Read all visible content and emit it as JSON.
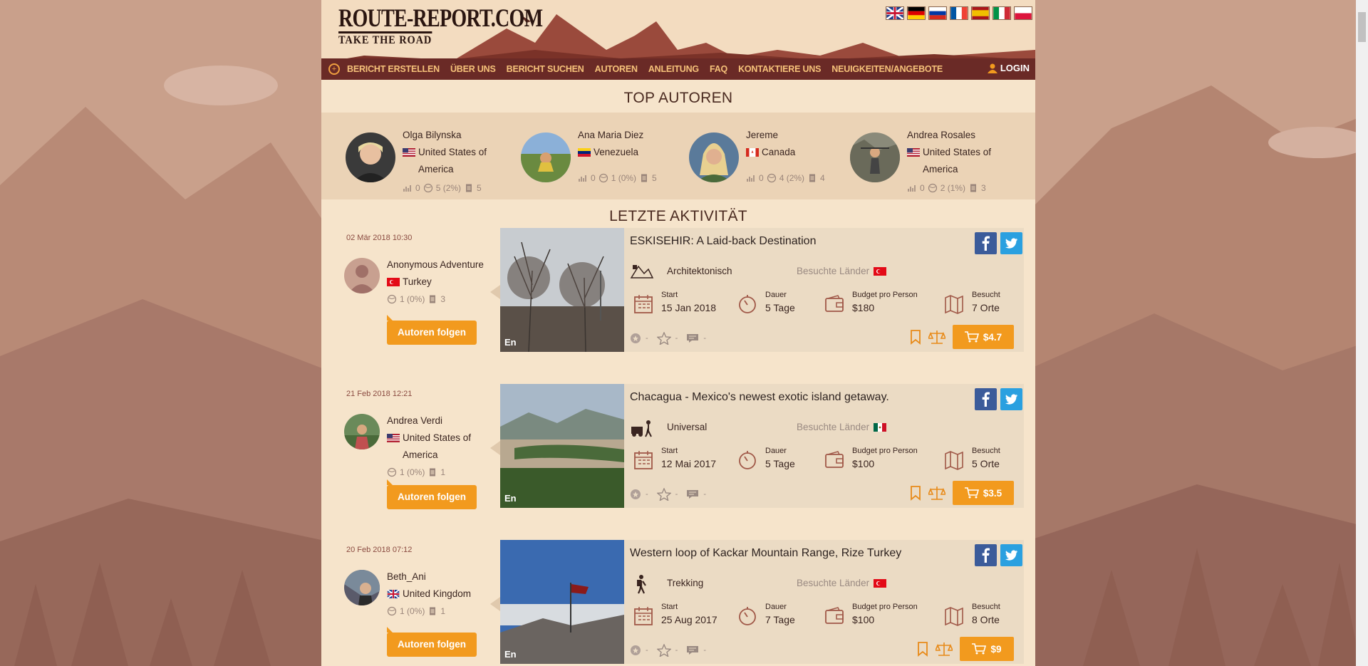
{
  "header": {
    "logo_line1": "ROUTE-REPORT.COM",
    "logo_line2": "TAKE THE ROAD",
    "flags": [
      "uk-flag-icon",
      "germany-flag-icon",
      "russia-flag-icon",
      "france-flag-icon",
      "spain-flag-icon",
      "italy-flag-icon",
      "poland-flag-icon"
    ]
  },
  "nav": {
    "items": [
      "BERICHT ERSTELLEN",
      "ÜBER UNS",
      "BERICHT SUCHEN",
      "AUTOREN",
      "ANLEITUNG",
      "FAQ",
      "KONTAKTIERE UNS",
      "NEUIGKEITEN/ANGEBOTE"
    ],
    "login": "LOGIN"
  },
  "top_authors": {
    "title": "TOP AUTOREN",
    "authors": [
      {
        "name": "Olga Bilynska",
        "country": "United States of America",
        "s1": "0",
        "s2": "5 (2%)",
        "s3": "5"
      },
      {
        "name": "Ana Maria Diez",
        "country": "Venezuela",
        "s1": "0",
        "s2": "1 (0%)",
        "s3": "5"
      },
      {
        "name": "Jereme",
        "country": "Canada",
        "s1": "0",
        "s2": "4 (2%)",
        "s3": "4"
      },
      {
        "name": "Andrea Rosales",
        "country": "United States of America",
        "s1": "0",
        "s2": "2 (1%)",
        "s3": "3"
      }
    ]
  },
  "activity": {
    "title": "LETZTE AKTIVITÄT",
    "follow_label": "Autoren folgen",
    "labels": {
      "start": "Start",
      "dauer": "Dauer",
      "budget": "Budget pro Person",
      "besucht": "Besucht",
      "visited_countries": "Besuchte Länder",
      "dash": "-",
      "lang": "En"
    },
    "items": [
      {
        "date": "02 Mär 2018 10:30",
        "author": "Anonymous Adventure",
        "country": "Turkey",
        "s2": "1 (0%)",
        "s3": "3",
        "title": "ESKISEHIR: A Laid-back Destination",
        "type": "Architektonisch",
        "start": "15 Jan 2018",
        "dauer": "5 Tage",
        "budget": "$180",
        "besucht": "7 Orte",
        "price": "$4.7"
      },
      {
        "date": "21 Feb 2018 12:21",
        "author": "Andrea Verdi",
        "country": "United States of America",
        "s2": "1 (0%)",
        "s3": "1",
        "title": "Chacagua - Mexico's newest exotic island getaway.",
        "type": "Universal",
        "start": "12 Mai 2017",
        "dauer": "5 Tage",
        "budget": "$100",
        "besucht": "5 Orte",
        "price": "$3.5"
      },
      {
        "date": "20 Feb 2018 07:12",
        "author": "Beth_Ani",
        "country": "United Kingdom",
        "s2": "1 (0%)",
        "s3": "1",
        "title": "Western loop of Kackar Mountain Range, Rize Turkey",
        "type": "Trekking",
        "start": "25 Aug 2017",
        "dauer": "7 Tage",
        "budget": "$100",
        "besucht": "8 Orte",
        "price": "$9"
      }
    ]
  }
}
